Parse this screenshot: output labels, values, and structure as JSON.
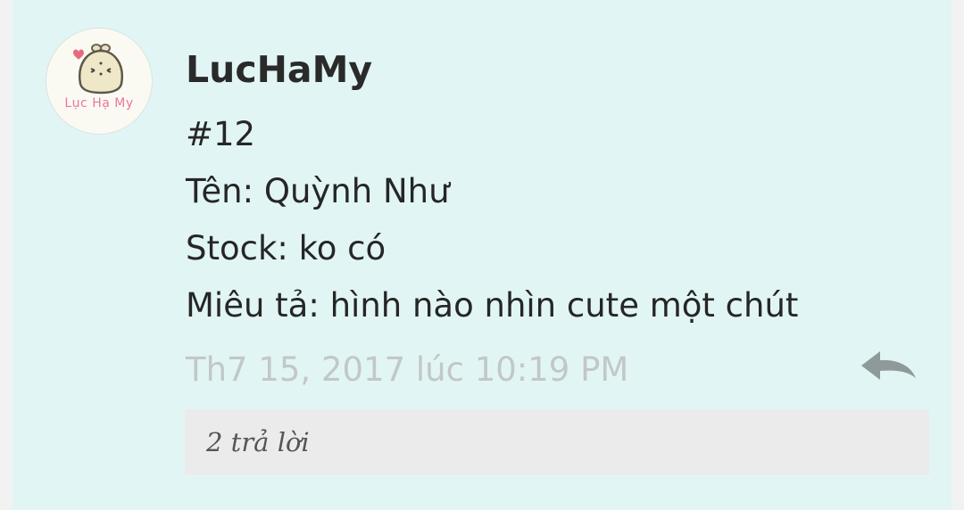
{
  "post": {
    "avatar": {
      "text": "Lục Hạ My",
      "icon": "bunny-mascot-icon"
    },
    "username": "LucHaMy",
    "lines": [
      "#12",
      "Tên: Quỳnh Như",
      "Stock: ko có",
      "Miêu tả: hình nào nhìn cute một chút"
    ],
    "timestamp": "Th7 15, 2017 lúc 10:19 PM",
    "reply_icon": "reply-arrow-icon",
    "replies_label": "2 trả lời"
  },
  "colors": {
    "card_background": "#e2f5f5",
    "replies_background": "#ebebeb",
    "timestamp_text": "#c2c7c7",
    "avatar_text": "#e8789a"
  }
}
